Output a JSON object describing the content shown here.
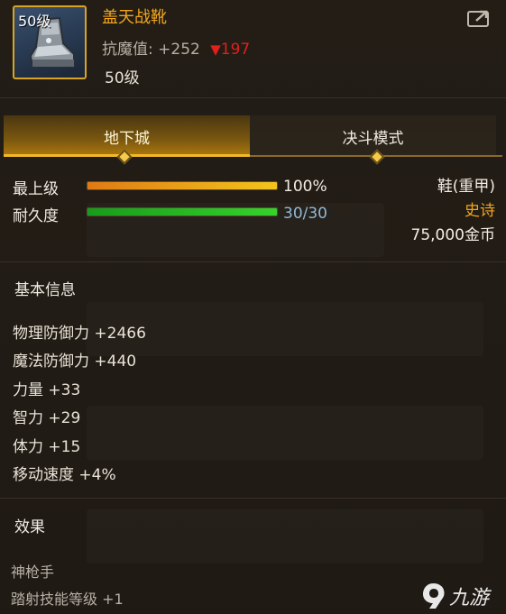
{
  "item": {
    "icon_level": "50级",
    "name": "盖天战靴",
    "stat_label": "抗魔值:",
    "stat_value": "+252",
    "stat_diff_arrow": "▼",
    "stat_diff": "197",
    "level": "50级",
    "icon": "armored-boot-icon"
  },
  "header": {
    "share_icon": "share-icon"
  },
  "tabs": [
    {
      "label": "地下城",
      "active": true
    },
    {
      "label": "决斗模式",
      "active": false
    }
  ],
  "bars": {
    "max_level": {
      "label": "最上级",
      "percent": 1.0,
      "text": "100%"
    },
    "durability": {
      "label": "耐久度",
      "current": 30,
      "max": 30,
      "text": "30/30"
    }
  },
  "type": {
    "slot": "鞋(重甲)",
    "rarity": "史诗",
    "price": "75,000金币"
  },
  "basic_info": {
    "title": "基本信息",
    "attributes": [
      "物理防御力 +2466",
      "魔法防御力 +440",
      "力量 +33",
      "智力 +29",
      "体力 +15",
      "移动速度 +4%"
    ]
  },
  "effects": {
    "title": "效果",
    "lines": [
      "神枪手",
      "踏射技能等级 +1"
    ]
  },
  "watermark": {
    "text": "九游"
  },
  "colors": {
    "accent_gold": "#f1a51c",
    "rarity_color": "#f1a51c",
    "decrease_red": "#e0201d",
    "durability_text": "#8fb8d8",
    "bar_orange": "#f2c51c",
    "bar_green": "#36d22b"
  }
}
